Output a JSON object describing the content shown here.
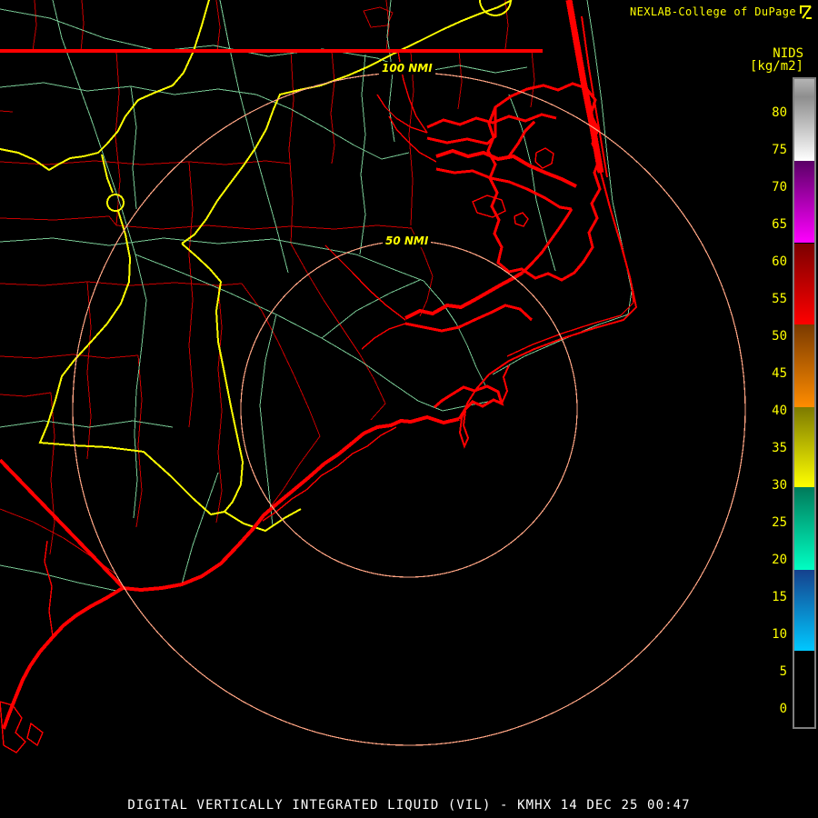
{
  "header": {
    "source_line": "NEXLAB-College of DuPage",
    "logo_icon": "college-of-dupage-mark",
    "format_label": "NIDS",
    "units_label": "[kg/m2]"
  },
  "range_rings": {
    "inner_label": "50 NMI",
    "outer_label": "100 NMI"
  },
  "scale": {
    "unit": "kg/m2",
    "ticks": [
      80,
      75,
      70,
      65,
      60,
      55,
      50,
      45,
      40,
      35,
      30,
      25,
      20,
      15,
      10,
      5,
      0
    ],
    "segments": [
      {
        "name": "gray",
        "from": 84.5,
        "to": 73.5,
        "top_color": "#b4b4b4",
        "mid_color": "#8e8e8e",
        "bottom_color": "#ffffff"
      },
      {
        "name": "purple",
        "from": 73.5,
        "to": 62.5,
        "top_color": "#5a0066",
        "bottom_color": "#ff00ff"
      },
      {
        "name": "red",
        "from": 62.5,
        "to": 51.6,
        "top_color": "#7c0000",
        "bottom_color": "#ff0000"
      },
      {
        "name": "orange",
        "from": 51.6,
        "to": 40.5,
        "top_color": "#7a3a00",
        "bottom_color": "#ff8c00"
      },
      {
        "name": "yellow",
        "from": 40.5,
        "to": 29.8,
        "top_color": "#7d7a00",
        "bottom_color": "#ffff00"
      },
      {
        "name": "teal",
        "from": 29.8,
        "to": 18.7,
        "top_color": "#007a5a",
        "bottom_color": "#00ffc3"
      },
      {
        "name": "blue",
        "from": 18.7,
        "to": 7.8,
        "top_color": "#15418d",
        "bottom_color": "#00c8ff"
      },
      {
        "name": "black",
        "from": 7.8,
        "to": -2.3,
        "top_color": "#000000",
        "bottom_color": "#000000"
      }
    ]
  },
  "footer": {
    "caption": "DIGITAL VERTICALLY INTEGRATED LIQUID (VIL) - KMHX 14 DEC 25 00:47"
  },
  "colors": {
    "background": "#000000",
    "coastline": "#ff0000",
    "county_lines": "#c80000",
    "roads": "#78c894",
    "highways": "#ffff00",
    "range_rings": "#ffa584",
    "labels": "#ffff00",
    "footer_text": "#ffffff",
    "scale_border": "#7e7e7e"
  }
}
